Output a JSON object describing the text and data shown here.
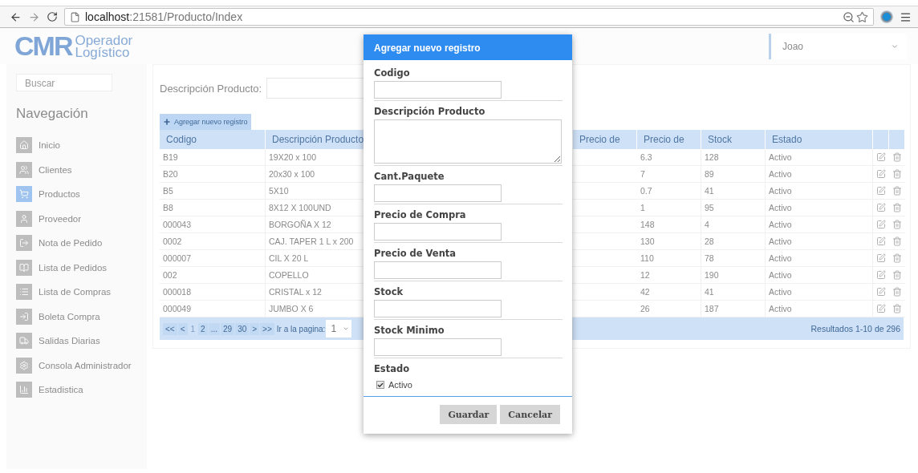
{
  "browser": {
    "url_host": "localhost",
    "url_path": ":21581/Producto/Index"
  },
  "brand": {
    "mark": "CMR",
    "line_1": "Operador",
    "line_2": "Logístico"
  },
  "user_menu": {
    "name": "Joao"
  },
  "sidebar": {
    "search_placeholder": "Buscar",
    "heading": "Navegación",
    "items": [
      {
        "label": "Inicio",
        "selected": false
      },
      {
        "label": "Clientes",
        "selected": false
      },
      {
        "label": "Productos",
        "selected": true
      },
      {
        "label": "Proveedor",
        "selected": false
      },
      {
        "label": "Nota de Pedido",
        "selected": false
      },
      {
        "label": "Lista de Pedidos",
        "selected": false
      },
      {
        "label": "Lista de Compras",
        "selected": false
      },
      {
        "label": "Boleta Compra",
        "selected": false
      },
      {
        "label": "Salidas Diarias",
        "selected": false
      },
      {
        "label": "Consola Administrador",
        "selected": false
      },
      {
        "label": "Estadistica",
        "selected": false
      }
    ]
  },
  "filter": {
    "label": "Descripción Producto:"
  },
  "add_button": "Agregar nuevo registro",
  "table": {
    "columns": [
      "Codigo",
      "Descripción Producto",
      "",
      "Precio de",
      "Precio de",
      "Stock",
      "Estado"
    ],
    "rows": [
      [
        "B19",
        "19X20 x 100",
        "6.3",
        "128",
        "Activo"
      ],
      [
        "B20",
        "20x30 x 100",
        "7",
        "89",
        "Activo"
      ],
      [
        "B5",
        "5X10",
        "0.7",
        "41",
        "Activo"
      ],
      [
        "B8",
        "8X12 X 100UND",
        "1",
        "95",
        "Activo"
      ],
      [
        "000043",
        "BORGOÑA X 12",
        "148",
        "4",
        "Activo"
      ],
      [
        "0002",
        "CAJ. TAPER 1 L x 200",
        "130",
        "28",
        "Activo"
      ],
      [
        "000007",
        "CIL X 20 L",
        "110",
        "78",
        "Activo"
      ],
      [
        "002",
        "COPELLO",
        "12",
        "190",
        "Activo"
      ],
      [
        "000018",
        "CRISTAL x 12",
        "42",
        "41",
        "Activo"
      ],
      [
        "000049",
        "JUMBO X 6",
        "26",
        "187",
        "Activo"
      ]
    ]
  },
  "pagination": {
    "pages": [
      {
        "label": "<<",
        "selected": false
      },
      {
        "label": "<",
        "selected": false
      },
      {
        "label": "1",
        "selected": true
      },
      {
        "label": "2",
        "selected": false
      },
      {
        "label": "...",
        "selected": false
      },
      {
        "label": "29",
        "selected": false
      },
      {
        "label": "30",
        "selected": false
      },
      {
        "label": ">",
        "selected": false
      },
      {
        "label": ">>",
        "selected": false
      }
    ],
    "goto_label": "Ir a la pagina:",
    "goto_value": "1",
    "results": "Resultados 1-10 de 296"
  },
  "dialog": {
    "title": "Agregar nuevo registro",
    "fields": [
      {
        "label": "Codigo",
        "kind": "input"
      },
      {
        "label": "Descripción Producto",
        "kind": "textarea"
      },
      {
        "label": "Cant.Paquete",
        "kind": "input"
      },
      {
        "label": "Precio de Compra",
        "kind": "input"
      },
      {
        "label": "Precio de Venta",
        "kind": "input"
      },
      {
        "label": "Stock",
        "kind": "input"
      },
      {
        "label": "Stock Minimo",
        "kind": "input"
      }
    ],
    "estado": {
      "label": "Estado",
      "option": "Activo",
      "checked": true
    },
    "buttons": [
      "Guardar",
      "Cancelar"
    ]
  }
}
